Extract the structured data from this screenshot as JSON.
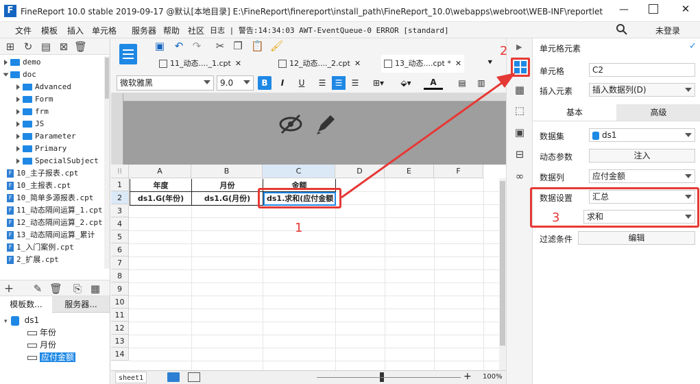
{
  "titlebar": {
    "title": "FineReport 10.0 stable 2019-09-17 @默认[本地目录]   E:\\FineReport\\finereport\\install_path\\FineReport_10.0\\webapps\\webroot\\WEB-INF\\reportlet..."
  },
  "menubar": {
    "items": [
      "文件",
      "模板",
      "插入",
      "单元格",
      "服务器",
      "帮助",
      "社区"
    ],
    "log": "日志 | 警告:14:34:03 AWT-EventQueue-0 ERROR [standard]",
    "login": "未登录"
  },
  "tree": {
    "items": [
      {
        "label": "demo",
        "type": "folder",
        "level": 0
      },
      {
        "label": "doc",
        "type": "folder",
        "level": 0,
        "open": true
      },
      {
        "label": "Advanced",
        "type": "folder",
        "level": 1
      },
      {
        "label": "Form",
        "type": "folder",
        "level": 1
      },
      {
        "label": "frm",
        "type": "folder",
        "level": 1
      },
      {
        "label": "JS",
        "type": "folder",
        "level": 1
      },
      {
        "label": "Parameter",
        "type": "folder",
        "level": 1
      },
      {
        "label": "Primary",
        "type": "folder",
        "level": 1
      },
      {
        "label": "SpecialSubject",
        "type": "folder",
        "level": 1
      },
      {
        "label": "10_主子报表.cpt",
        "type": "file",
        "level": 0
      },
      {
        "label": "10_主报表.cpt",
        "type": "file",
        "level": 0
      },
      {
        "label": "10_简单多源报表.cpt",
        "type": "file",
        "level": 0
      },
      {
        "label": "11_动态隔间运算_1.cpt",
        "type": "file",
        "level": 0
      },
      {
        "label": "12_动态隔间运算_2.cpt",
        "type": "file",
        "level": 0
      },
      {
        "label": "13_动态隔间运算_累计",
        "type": "file",
        "level": 0
      },
      {
        "label": "1_入门案例.cpt",
        "type": "file",
        "level": 0
      },
      {
        "label": "2_扩展.cpt",
        "type": "file",
        "level": 0
      }
    ]
  },
  "lefttabs": {
    "tab1": "模板数...",
    "tab2": "服务器..."
  },
  "dataset": {
    "name": "ds1",
    "fields": [
      "年份",
      "月份",
      "应付金额"
    ]
  },
  "tabs": [
    {
      "label": "11_动态...._1.cpt"
    },
    {
      "label": "12_动态...._2.cpt"
    },
    {
      "label": "13_动态....cpt *"
    }
  ],
  "format": {
    "font": "微软雅黑",
    "size": "9.0"
  },
  "grid": {
    "columns": [
      "A",
      "B",
      "C",
      "D",
      "E",
      "F"
    ],
    "rows": [
      "1",
      "2",
      "3",
      "4",
      "5",
      "6",
      "7",
      "8",
      "9",
      "10",
      "11",
      "12",
      "13",
      "14"
    ],
    "headers": [
      "年度",
      "月份",
      "金额"
    ],
    "row2": [
      "ds1.G(年份)",
      "ds1.G(月份)",
      "ds1.求和(应付金额"
    ]
  },
  "sheet": {
    "name": "sheet1",
    "zoom": "100%"
  },
  "panel": {
    "title": "单元格元素",
    "cell_label": "单元格",
    "cell_value": "C2",
    "insert_label": "插入元素",
    "insert_value": "插入数据列(D)",
    "tab_basic": "基本",
    "tab_adv": "高级",
    "dataset_label": "数据集",
    "dataset_value": "ds1",
    "dynparam_label": "动态参数",
    "dynparam_btn": "注入",
    "column_label": "数据列",
    "column_value": "应付金额",
    "setting_label": "数据设置",
    "setting_value": "汇总",
    "agg_value": "求和",
    "filter_label": "过滤条件",
    "filter_btn": "编辑"
  },
  "annotations": {
    "n1": "1",
    "n2": "2",
    "n3": "3"
  },
  "colors": {
    "accent": "#1e88e5",
    "annotation": "#e53935"
  }
}
